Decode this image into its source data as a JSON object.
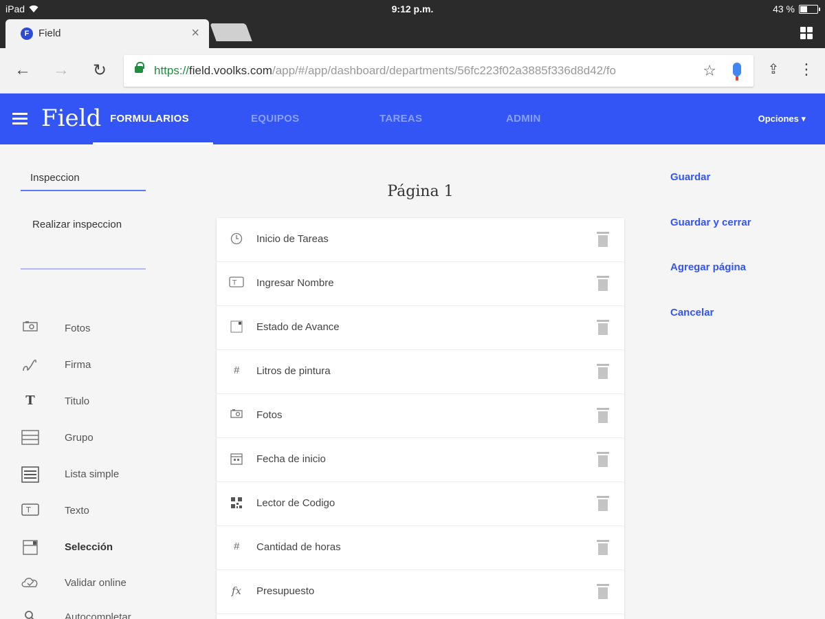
{
  "status": {
    "device": "iPad",
    "time": "9:12 p.m.",
    "battery": "43 %",
    "battery_level": 0.43
  },
  "browser": {
    "tab_title": "Field",
    "tab_favicon": "F",
    "url_scheme": "https://",
    "url_host": "field.voolks.com",
    "url_path": "/app/#/app/dashboard/departments/56fc223f02a3885f336d8d42/fo"
  },
  "app": {
    "brand": "Field",
    "nav": [
      "FORMULARIOS",
      "EQUIPOS",
      "TAREAS",
      "ADMIN"
    ],
    "active_nav": "FORMULARIOS",
    "options": "Opciones ▾",
    "accent_color": "#3355f5"
  },
  "form": {
    "name": "Inspeccion",
    "description": "Realizar inspeccion"
  },
  "tools": [
    {
      "label": "Fotos",
      "icon": "camera-icon",
      "bold": false
    },
    {
      "label": "Firma",
      "icon": "signature-icon",
      "bold": false
    },
    {
      "label": "Titulo",
      "icon": "title-icon",
      "bold": false
    },
    {
      "label": "Grupo",
      "icon": "group-icon",
      "bold": false
    },
    {
      "label": "Lista simple",
      "icon": "list-icon",
      "bold": false
    },
    {
      "label": "Texto",
      "icon": "text-icon",
      "bold": false
    },
    {
      "label": "Selección",
      "icon": "selection-icon",
      "bold": true
    },
    {
      "label": "Validar online",
      "icon": "cloud-check-icon",
      "bold": false
    },
    {
      "label": "Autocompletar",
      "icon": "search-icon",
      "bold": false
    }
  ],
  "page": {
    "title": "Página 1",
    "fields": [
      {
        "label": "Inicio de Tareas",
        "icon": "clock-icon"
      },
      {
        "label": "Ingresar Nombre",
        "icon": "text-icon"
      },
      {
        "label": "Estado de Avance",
        "icon": "selection-icon"
      },
      {
        "label": "Litros de pintura",
        "icon": "number-icon"
      },
      {
        "label": "Fotos",
        "icon": "camera-icon"
      },
      {
        "label": "Fecha de inicio",
        "icon": "calendar-icon"
      },
      {
        "label": "Lector de Codigo",
        "icon": "qr-code-icon"
      },
      {
        "label": "Cantidad de horas",
        "icon": "number-icon"
      },
      {
        "label": "Presupuesto",
        "icon": "formula-icon"
      }
    ]
  },
  "actions": {
    "save": "Guardar",
    "save_close": "Guardar y cerrar",
    "add_page": "Agregar página",
    "cancel": "Cancelar"
  }
}
